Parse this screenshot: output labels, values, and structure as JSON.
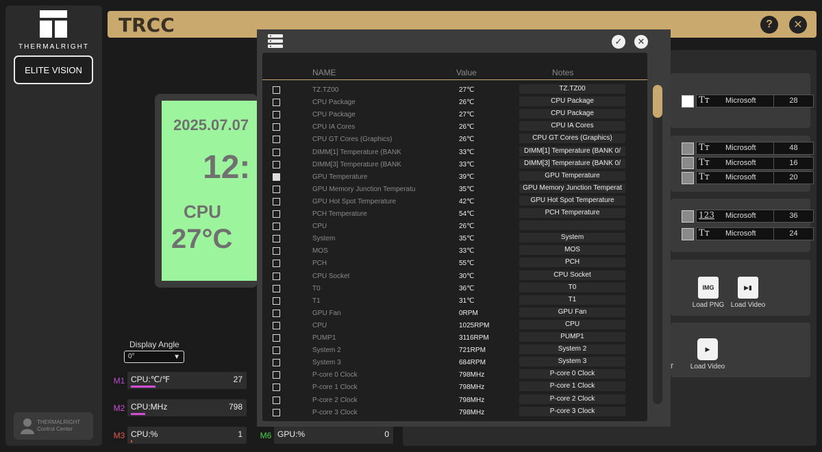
{
  "sidebar": {
    "brand": "THERMALRIGHT",
    "device_button": "ELITE VISION",
    "badge_line1": "THERMALRIGHT",
    "badge_line2": "Control Center"
  },
  "header": {
    "title": "TRCC",
    "help_icon": "question-icon",
    "close_icon": "close-icon"
  },
  "preview": {
    "date": "2025.07.07",
    "time": "12:",
    "label": "CPU",
    "temp": "27°C"
  },
  "display_angle": {
    "label": "Display Angle",
    "value": "0°"
  },
  "metrics": [
    {
      "tag": "M1",
      "tag_color": "#b44bd0",
      "label": "CPU:℃/℉",
      "value": "27",
      "fill": 0.22
    },
    {
      "tag": "M2",
      "tag_color": "#d24dd8",
      "label": "CPU:MHz",
      "value": "798",
      "fill": 0.13
    },
    {
      "tag": "M3",
      "tag_color": "#e05a4a",
      "label": "CPU:%",
      "value": "1",
      "fill": 0.01
    },
    {
      "tag": "M6",
      "tag_color": "#4ad04a",
      "label": "GPU:%",
      "value": "0",
      "fill": 0
    }
  ],
  "right_panels": {
    "font_rows": [
      {
        "icon": "Tт",
        "font": "Microsoft",
        "size": "28",
        "swatch": "#ffffff"
      },
      {
        "icon": "Tт",
        "font": "Microsoft",
        "size": "48",
        "swatch": "#8a8a8a"
      },
      {
        "icon": "Tт",
        "font": "Microsoft",
        "size": "16",
        "swatch": "#8a8a8a"
      },
      {
        "icon": "Tт",
        "font": "Microsoft",
        "size": "20",
        "swatch": "#8a8a8a"
      },
      {
        "icon": "123",
        "font": "Microsoft",
        "size": "36",
        "swatch": "#8a8a8a"
      },
      {
        "icon": "Tт",
        "font": "Microsoft",
        "size": "24",
        "swatch": "#8a8a8a"
      }
    ],
    "load_png": "Load PNG",
    "load_video_1": "Load Video",
    "load_video_2": "Load Video",
    "img_icon_text": "IMG",
    "partial_char": "r"
  },
  "modal": {
    "icon": "sensor-list-icon",
    "confirm_icon": "check-icon",
    "close_icon": "close-icon",
    "columns": {
      "name": "NAME",
      "value": "Value",
      "notes": "Notes"
    },
    "rows": [
      {
        "checked": false,
        "name": "TZ.TZ00",
        "value": "27℃",
        "note": "TZ.TZ00"
      },
      {
        "checked": false,
        "name": "CPU Package",
        "value": "26℃",
        "note": "CPU Package"
      },
      {
        "checked": false,
        "name": "CPU Package",
        "value": "27℃",
        "note": "CPU Package"
      },
      {
        "checked": false,
        "name": "CPU IA Cores",
        "value": "26℃",
        "note": "CPU IA Cores"
      },
      {
        "checked": false,
        "name": "CPU GT Cores (Graphics)",
        "value": "26℃",
        "note": "CPU GT Cores (Graphics)"
      },
      {
        "checked": false,
        "name": "DIMM[1] Temperature (BANK",
        "value": "33℃",
        "note": "DIMM[1] Temperature (BANK 0/"
      },
      {
        "checked": false,
        "name": "DIMM[3] Temperature (BANK",
        "value": "33℃",
        "note": "DIMM[3] Temperature (BANK 0/"
      },
      {
        "checked": true,
        "name": "GPU Temperature",
        "value": "39℃",
        "note": "GPU Temperature"
      },
      {
        "checked": false,
        "name": "GPU Memory Junction Temperature",
        "value": "35℃",
        "note": "GPU Memory Junction Temperat"
      },
      {
        "checked": false,
        "name": "GPU Hot Spot Temperature",
        "value": "42℃",
        "note": "GPU Hot Spot Temperature"
      },
      {
        "checked": false,
        "name": "PCH Temperature",
        "value": "54℃",
        "note": "PCH Temperature"
      },
      {
        "checked": false,
        "name": "CPU",
        "value": "26℃",
        "note": ""
      },
      {
        "checked": false,
        "name": "System",
        "value": "35℃",
        "note": "System"
      },
      {
        "checked": false,
        "name": "MOS",
        "value": "33℃",
        "note": "MOS"
      },
      {
        "checked": false,
        "name": "PCH",
        "value": "55℃",
        "note": "PCH"
      },
      {
        "checked": false,
        "name": "CPU Socket",
        "value": "30℃",
        "note": "CPU Socket"
      },
      {
        "checked": false,
        "name": "T0",
        "value": "36℃",
        "note": "T0"
      },
      {
        "checked": false,
        "name": "T1",
        "value": "31℃",
        "note": "T1"
      },
      {
        "checked": false,
        "name": "GPU Fan",
        "value": "0RPM",
        "note": "GPU Fan"
      },
      {
        "checked": false,
        "name": "CPU",
        "value": "1025RPM",
        "note": "CPU"
      },
      {
        "checked": false,
        "name": "PUMP1",
        "value": "3116RPM",
        "note": "PUMP1"
      },
      {
        "checked": false,
        "name": "System 2",
        "value": "721RPM",
        "note": "System 2"
      },
      {
        "checked": false,
        "name": "System 3",
        "value": "684RPM",
        "note": "System 3"
      },
      {
        "checked": false,
        "name": "P-core 0 Clock",
        "value": "798MHz",
        "note": "P-core 0 Clock"
      },
      {
        "checked": false,
        "name": "P-core 1 Clock",
        "value": "798MHz",
        "note": "P-core 1 Clock"
      },
      {
        "checked": false,
        "name": "P-core 2 Clock",
        "value": "798MHz",
        "note": "P-core 2 Clock"
      },
      {
        "checked": false,
        "name": "P-core 3 Clock",
        "value": "798MHz",
        "note": "P-core 3 Clock"
      }
    ]
  }
}
